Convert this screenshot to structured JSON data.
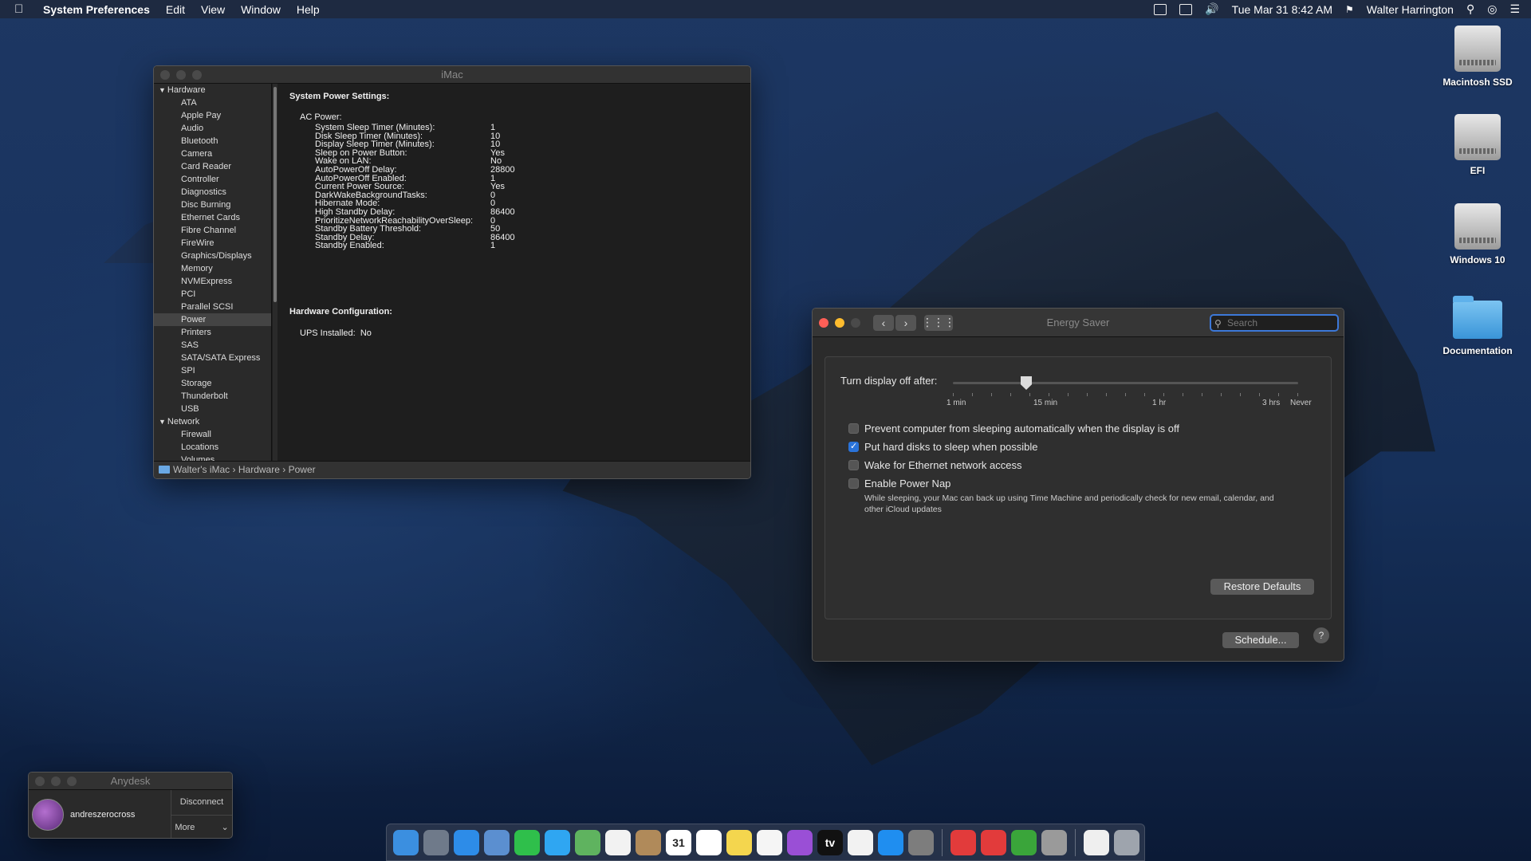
{
  "menubar": {
    "app": "System Preferences",
    "items": [
      "Edit",
      "View",
      "Window",
      "Help"
    ],
    "datetime": "Tue Mar 31  8:42 AM",
    "user": "Walter Harrington"
  },
  "desktop_icons": [
    {
      "label": "Macintosh SSD",
      "icon": "hard-drive-icon"
    },
    {
      "label": "EFI",
      "icon": "hard-drive-icon"
    },
    {
      "label": "Windows 10",
      "icon": "hard-drive-icon"
    },
    {
      "label": "Documentation",
      "icon": "folder-icon"
    }
  ],
  "sysinfo": {
    "title": "iMac",
    "sidebar": {
      "hardware_label": "Hardware",
      "hardware_items": [
        "ATA",
        "Apple Pay",
        "Audio",
        "Bluetooth",
        "Camera",
        "Card Reader",
        "Controller",
        "Diagnostics",
        "Disc Burning",
        "Ethernet Cards",
        "Fibre Channel",
        "FireWire",
        "Graphics/Displays",
        "Memory",
        "NVMExpress",
        "PCI",
        "Parallel SCSI",
        "Power",
        "Printers",
        "SAS",
        "SATA/SATA Express",
        "SPI",
        "Storage",
        "Thunderbolt",
        "USB"
      ],
      "selected": "Power",
      "network_label": "Network",
      "network_items": [
        "Firewall",
        "Locations",
        "Volumes"
      ]
    },
    "content": {
      "heading1": "System Power Settings:",
      "ac_power_label": "AC Power:",
      "settings": [
        {
          "k": "System Sleep Timer (Minutes):",
          "v": "1"
        },
        {
          "k": "Disk Sleep Timer (Minutes):",
          "v": "10"
        },
        {
          "k": "Display Sleep Timer (Minutes):",
          "v": "10"
        },
        {
          "k": "Sleep on Power Button:",
          "v": "Yes"
        },
        {
          "k": "Wake on LAN:",
          "v": "No"
        },
        {
          "k": "AutoPowerOff Delay:",
          "v": "28800"
        },
        {
          "k": "AutoPowerOff Enabled:",
          "v": "1"
        },
        {
          "k": "Current Power Source:",
          "v": "Yes"
        },
        {
          "k": "DarkWakeBackgroundTasks:",
          "v": "0"
        },
        {
          "k": "Hibernate Mode:",
          "v": "0"
        },
        {
          "k": "High Standby Delay:",
          "v": "86400"
        },
        {
          "k": "PrioritizeNetworkReachabilityOverSleep:",
          "v": "0"
        },
        {
          "k": "Standby Battery Threshold:",
          "v": "50"
        },
        {
          "k": "Standby Delay:",
          "v": "86400"
        },
        {
          "k": "Standby Enabled:",
          "v": "1"
        }
      ],
      "heading2": "Hardware Configuration:",
      "ups_label": "UPS Installed:",
      "ups_value": "No"
    },
    "pathbar": [
      "Walter's iMac",
      "Hardware",
      "Power"
    ]
  },
  "energy": {
    "title": "Energy Saver",
    "search_placeholder": "Search",
    "slider_label": "Turn display off after:",
    "slider_value_minutes": 10,
    "tick_labels": [
      "1 min",
      "15 min",
      "1 hr",
      "3 hrs",
      "Never"
    ],
    "checkboxes": [
      {
        "label": "Prevent computer from sleeping automatically when the display is off",
        "checked": false
      },
      {
        "label": "Put hard disks to sleep when possible",
        "checked": true
      },
      {
        "label": "Wake for Ethernet network access",
        "checked": false
      },
      {
        "label": "Enable Power Nap",
        "checked": false
      }
    ],
    "power_nap_desc": "While sleeping, your Mac can back up using Time Machine and periodically check for new email, calendar, and other iCloud updates",
    "restore_label": "Restore Defaults",
    "schedule_label": "Schedule...",
    "help_label": "?"
  },
  "anydesk": {
    "title": "Anydesk",
    "user": "andreszerocross",
    "disconnect": "Disconnect",
    "more": "More"
  },
  "dock": {
    "apps": [
      "finder-icon",
      "launchpad-icon",
      "safari-icon",
      "preview-icon",
      "facetime-icon",
      "messages-icon",
      "maps-icon",
      "photos-icon",
      "contacts-icon",
      "calendar-icon",
      "reminders-icon",
      "notes-icon",
      "music-icon",
      "podcasts-icon",
      "tv-icon",
      "news-icon",
      "app-store-icon",
      "system-preferences-icon",
      "anydesk-icon",
      "anydesk-icon-2",
      "activity-icon",
      "automator-icon",
      "document-icon",
      "trash-icon"
    ],
    "calendar_day": "31",
    "tv_label": "tv"
  },
  "colors": {
    "accent": "#2a73d9",
    "window_bg": "#1e1e1e"
  }
}
